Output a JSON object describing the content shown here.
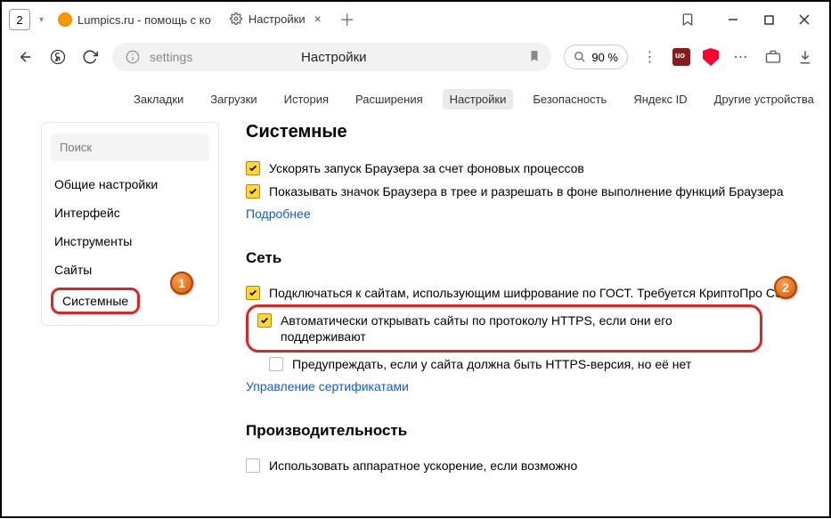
{
  "titlebar": {
    "tab_count": "2",
    "tabs": [
      {
        "title": "Lumpics.ru - помощь с ко"
      },
      {
        "title": "Настройки"
      }
    ]
  },
  "addressbar": {
    "url_text": "settings",
    "center_title": "Настройки",
    "zoom": "90 %"
  },
  "topnav": {
    "items": [
      "Закладки",
      "Загрузки",
      "История",
      "Расширения",
      "Настройки",
      "Безопасность",
      "Яндекс ID",
      "Другие устройства"
    ],
    "active_index": 4
  },
  "sidebar": {
    "search_placeholder": "Поиск",
    "items": [
      "Общие настройки",
      "Интерфейс",
      "Инструменты",
      "Сайты",
      "Системные"
    ],
    "selected_index": 4
  },
  "content": {
    "system_heading": "Системные",
    "system_opts": [
      "Ускорять запуск Браузера за счет фоновых процессов",
      "Показывать значок Браузера в трее и разрешать в фоне выполнение функций Браузера"
    ],
    "more_link": "Подробнее",
    "network_heading": "Сеть",
    "network_opts": [
      "Подключаться к сайтам, использующим шифрование по ГОСТ. Требуется КриптоПро CSP.",
      "Автоматически открывать сайты по протоколу HTTPS, если они его поддерживают",
      "Предупреждать, если у сайта должна быть HTTPS-версия, но её нет"
    ],
    "cert_link": "Управление сертификатами",
    "perf_heading": "Производительность",
    "perf_opts": [
      "Использовать аппаратное ускорение, если возможно"
    ]
  },
  "callouts": {
    "one": "1",
    "two": "2"
  }
}
